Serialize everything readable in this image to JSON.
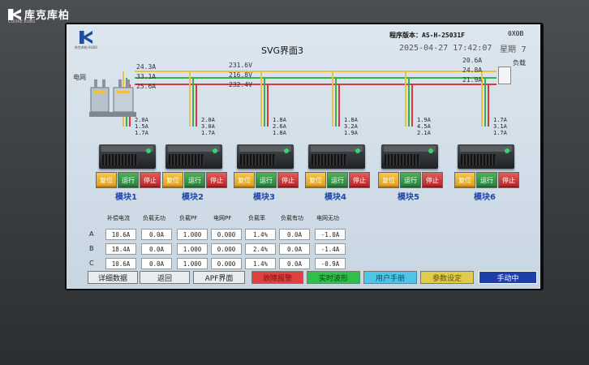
{
  "brand": {
    "name": "库克库柏",
    "tagline": "COOKE KUBO"
  },
  "header": {
    "logo_text": "库克库柏 KUBO",
    "title": "SVG界面3",
    "program_version": "程序版本：AS-H-25031F",
    "code": "0X0B",
    "date": "2025-04-27",
    "time": "17:42:07",
    "weekday_label": "星期",
    "weekday": "7"
  },
  "labels": {
    "grid": "电网",
    "load": "负载"
  },
  "grid_currents": [
    "24.3A",
    "33.1A",
    "25.6A"
  ],
  "grid_voltages": [
    "231.6V",
    "216.8V",
    "232.4V"
  ],
  "load_currents": [
    "20.6A",
    "24.8A",
    "21.9A"
  ],
  "bus_colors": {
    "phase_a": "#e8c23a",
    "phase_b": "#3ab04a",
    "phase_c": "#d83a3a"
  },
  "modules": [
    {
      "name": "模块1",
      "values": [
        "2.0A",
        "1.5A",
        "1.7A"
      ]
    },
    {
      "name": "模块2",
      "values": [
        "2.0A",
        "3.0A",
        "1.7A"
      ]
    },
    {
      "name": "模块3",
      "values": [
        "1.8A",
        "2.6A",
        "1.8A"
      ]
    },
    {
      "name": "模块4",
      "values": [
        "1.8A",
        "3.2A",
        "1.9A"
      ]
    },
    {
      "name": "模块5",
      "values": [
        "1.9A",
        "4.5A",
        "2.1A"
      ]
    },
    {
      "name": "模块6",
      "values": [
        "1.7A",
        "3.1A",
        "1.7A"
      ]
    }
  ],
  "module_buttons": {
    "reset": "复位",
    "run": "运行",
    "stop": "停止"
  },
  "table": {
    "headers": [
      "补偿电流",
      "负载无功",
      "负载PF",
      "电网PF",
      "负载率",
      "负载有功",
      "电网无功"
    ],
    "rows": [
      {
        "label": "A",
        "cells": [
          "10.6A",
          "0.0A",
          "1.000",
          "0.000",
          "1.4%",
          "0.0A",
          "-1.0A"
        ]
      },
      {
        "label": "B",
        "cells": [
          "18.4A",
          "0.0A",
          "1.000",
          "0.000",
          "2.4%",
          "0.0A",
          "-1.4A"
        ]
      },
      {
        "label": "C",
        "cells": [
          "10.6A",
          "0.0A",
          "1.000",
          "0.000",
          "1.4%",
          "0.0A",
          "-0.9A"
        ]
      }
    ]
  },
  "nav": {
    "detail": "详细数据",
    "back": "返回",
    "apf": "APF界面",
    "fault": "故障报警",
    "waveform": "实时波形",
    "manual": "用户手册",
    "params": "参数设定",
    "mode": "手动中"
  }
}
